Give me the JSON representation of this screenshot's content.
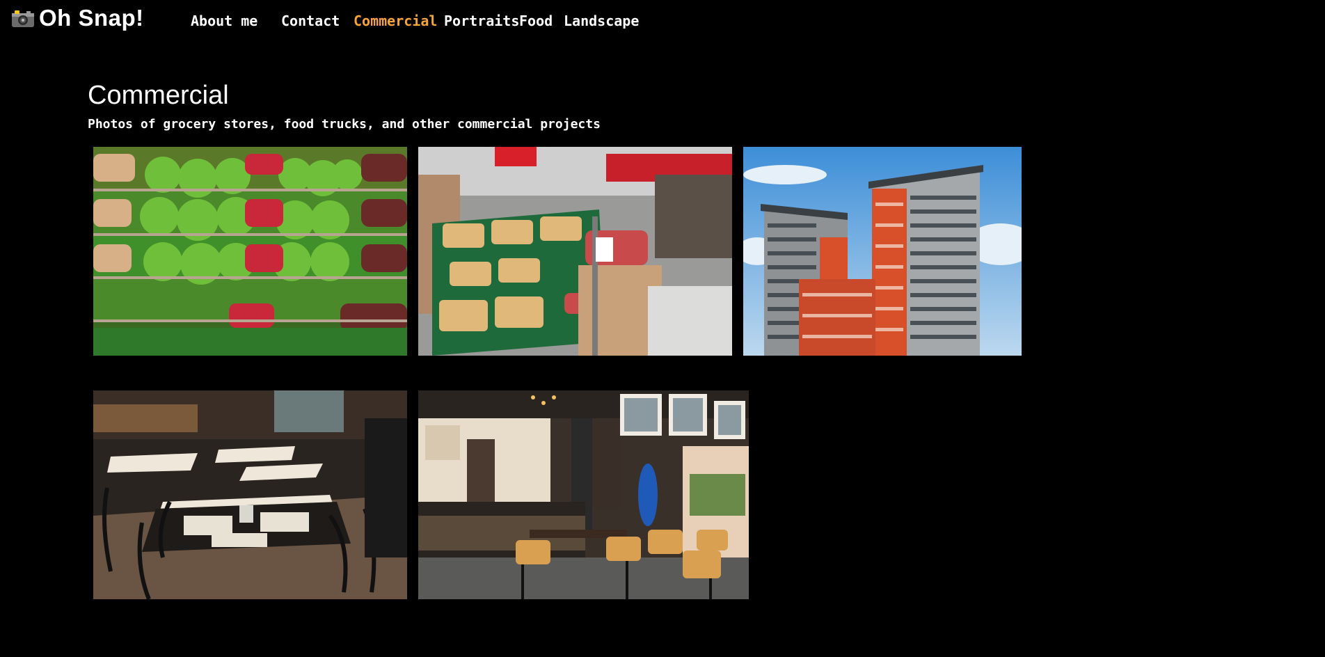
{
  "site": {
    "name": "Oh Snap!",
    "logo_icon": "camera-icon"
  },
  "nav": {
    "items": [
      {
        "label": "About me"
      },
      {
        "label": "Contact"
      },
      {
        "label": "Commercial",
        "active": true
      },
      {
        "label": "Portraits"
      },
      {
        "label": "Food"
      },
      {
        "label": "Landscape"
      }
    ],
    "active_color": "#f7a43a"
  },
  "page": {
    "title": "Commercial",
    "subtitle": "Photos of grocery stores, food trucks, and other commercial projects"
  },
  "gallery": {
    "photos": [
      {
        "subject": "produce-shelves"
      },
      {
        "subject": "supermarket-aisle"
      },
      {
        "subject": "apartment-tower"
      },
      {
        "subject": "restaurant-dining-room"
      },
      {
        "subject": "cafe-interior"
      }
    ]
  }
}
